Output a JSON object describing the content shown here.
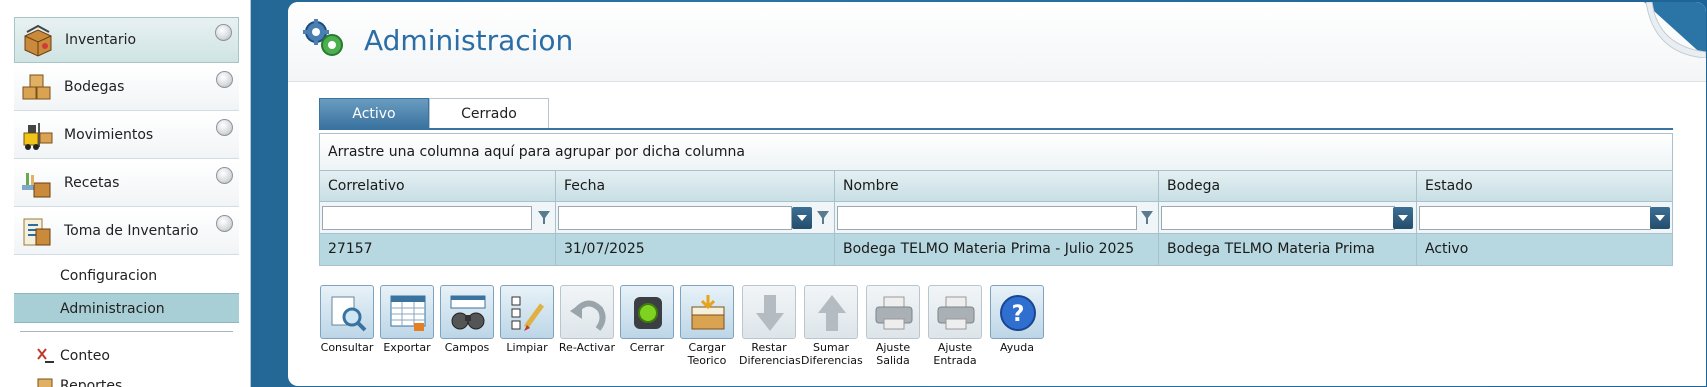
{
  "sidebar": {
    "items": [
      {
        "label": "Inventario",
        "icon": "box-icon"
      },
      {
        "label": "Bodegas",
        "icon": "boxes-icon"
      },
      {
        "label": "Movimientos",
        "icon": "forklift-icon"
      },
      {
        "label": "Recetas",
        "icon": "recipe-icon"
      },
      {
        "label": "Toma de Inventario",
        "icon": "clipboard-icon"
      }
    ],
    "subitems": [
      {
        "label": "Configuracion"
      },
      {
        "label": "Administracion"
      }
    ],
    "extra": [
      {
        "label": "Conteo",
        "icon": "count-icon"
      },
      {
        "label": "Reportes",
        "icon": "reports-icon"
      }
    ]
  },
  "header": {
    "title": "Administracion"
  },
  "tabs": [
    {
      "label": "Activo"
    },
    {
      "label": "Cerrado"
    }
  ],
  "grid": {
    "group_hint": "Arrastre una columna aquí para agrupar por dicha columna",
    "columns": [
      "Correlativo",
      "Fecha",
      "Nombre",
      "Bodega",
      "Estado"
    ],
    "rows": [
      [
        "27157",
        "31/07/2025",
        "Bodega TELMO Materia Prima - Julio 2025",
        "Bodega TELMO Materia Prima",
        "Activo"
      ]
    ]
  },
  "toolbar": [
    {
      "label": "Consultar",
      "icon": "query-icon"
    },
    {
      "label": "Exportar",
      "icon": "export-icon"
    },
    {
      "label": "Campos",
      "icon": "binoculars-icon"
    },
    {
      "label": "Limpiar",
      "icon": "clear-icon"
    },
    {
      "label": "Re-Activar",
      "icon": "undo-icon"
    },
    {
      "label": "Cerrar",
      "icon": "traffic-light-icon"
    },
    {
      "label": "Cargar\nTeorico",
      "icon": "load-icon"
    },
    {
      "label": "Restar\nDiferencias",
      "icon": "arrow-down-icon"
    },
    {
      "label": "Sumar\nDiferencias",
      "icon": "arrow-up-icon"
    },
    {
      "label": "Ajuste\nSalida",
      "icon": "printer-icon"
    },
    {
      "label": "Ajuste\nEntrada",
      "icon": "printer-icon"
    },
    {
      "label": "Ayuda",
      "icon": "help-icon"
    }
  ]
}
